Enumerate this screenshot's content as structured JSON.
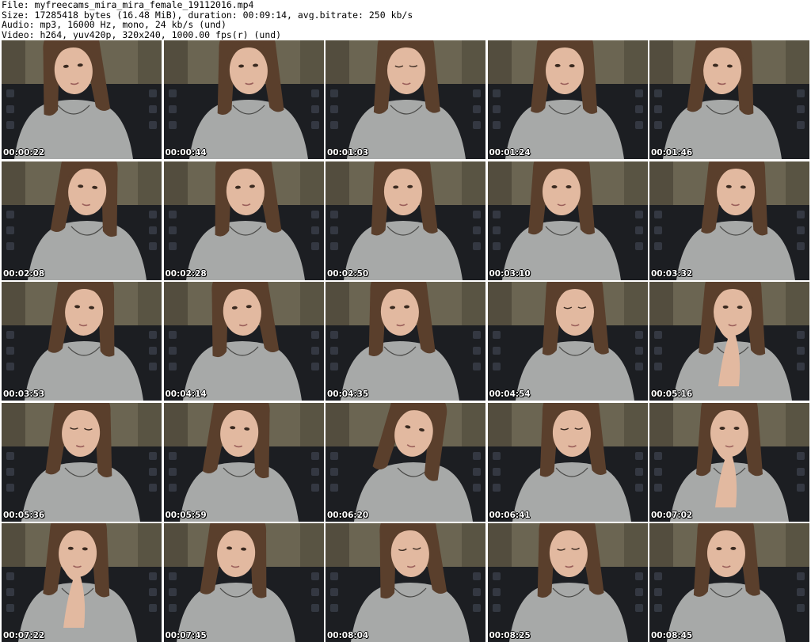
{
  "header": {
    "file_line": "File: myfreecams_mira_mira_female_19112016.mp4",
    "size_line": "Size: 17285418 bytes (16.48 MiB), duration: 00:09:14, avg.bitrate: 250 kb/s",
    "audio_line": "Audio: mp3, 16000 Hz, mono, 24 kb/s (und)",
    "video_line": "Video: h264, yuv420p, 320x240, 1000.00 fps(r) (und)"
  },
  "thumbnails": [
    {
      "timestamp": "00:00:22",
      "pose": "straight"
    },
    {
      "timestamp": "00:00:44",
      "pose": "straight"
    },
    {
      "timestamp": "00:01:03",
      "pose": "eyes-closed"
    },
    {
      "timestamp": "00:01:24",
      "pose": "straight"
    },
    {
      "timestamp": "00:01:46",
      "pose": "straight"
    },
    {
      "timestamp": "00:02:08",
      "pose": "straight"
    },
    {
      "timestamp": "00:02:28",
      "pose": "straight"
    },
    {
      "timestamp": "00:02:50",
      "pose": "straight"
    },
    {
      "timestamp": "00:03:10",
      "pose": "straight"
    },
    {
      "timestamp": "00:03:32",
      "pose": "straight"
    },
    {
      "timestamp": "00:03:53",
      "pose": "straight"
    },
    {
      "timestamp": "00:04:14",
      "pose": "straight"
    },
    {
      "timestamp": "00:04:35",
      "pose": "straight"
    },
    {
      "timestamp": "00:04:54",
      "pose": "eyes-closed"
    },
    {
      "timestamp": "00:05:16",
      "pose": "hand-on-chin"
    },
    {
      "timestamp": "00:05:36",
      "pose": "eyes-closed"
    },
    {
      "timestamp": "00:05:59",
      "pose": "straight"
    },
    {
      "timestamp": "00:06:20",
      "pose": "tilted"
    },
    {
      "timestamp": "00:06:41",
      "pose": "eyes-closed"
    },
    {
      "timestamp": "00:07:02",
      "pose": "hand-on-chin"
    },
    {
      "timestamp": "00:07:22",
      "pose": "hand-on-chin"
    },
    {
      "timestamp": "00:07:45",
      "pose": "straight"
    },
    {
      "timestamp": "00:08:04",
      "pose": "eyes-closed"
    },
    {
      "timestamp": "00:08:25",
      "pose": "eyes-closed"
    },
    {
      "timestamp": "00:08:45",
      "pose": "straight"
    }
  ],
  "colors": {
    "wall": "#6b6552",
    "wall_dark": "#3f3b2e",
    "chair": "#1c1e22",
    "chair_pattern": "#3a3f4a",
    "hair": "#5a3f2c",
    "skin": "#e2b9a0",
    "shirt": "#a7a9a8",
    "timestamp_text": "#ffffff"
  }
}
